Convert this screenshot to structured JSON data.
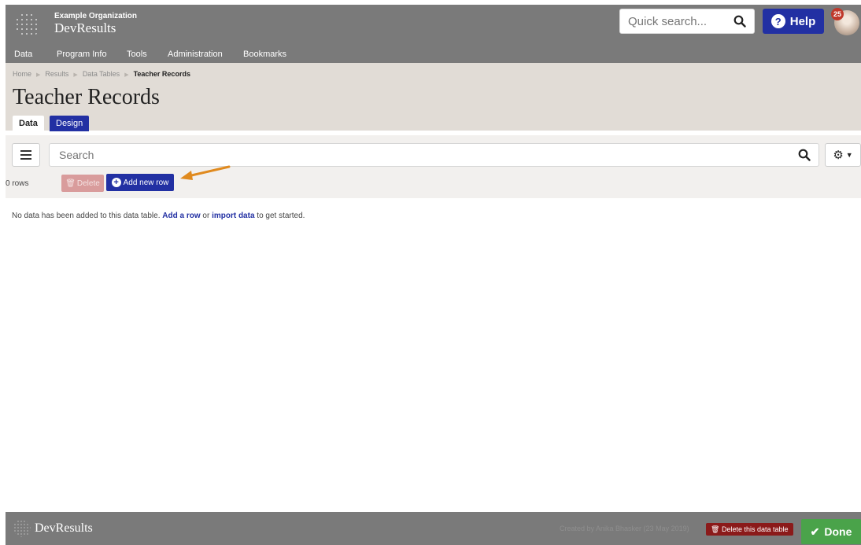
{
  "header": {
    "org_name": "Example Organization",
    "app_name": "DevResults",
    "quick_search_placeholder": "Quick search...",
    "help_label": "Help",
    "notification_count": "25"
  },
  "nav": {
    "items": [
      "Data",
      "Program Info",
      "Tools",
      "Administration",
      "Bookmarks"
    ]
  },
  "breadcrumb": {
    "items": [
      "Home",
      "Results",
      "Data Tables"
    ],
    "current": "Teacher Records"
  },
  "page": {
    "title": "Teacher Records",
    "tabs": [
      "Data",
      "Design"
    ]
  },
  "toolbar": {
    "search_placeholder": "Search",
    "rows_count": "0 rows",
    "delete_label": "Delete",
    "add_label": "Add new row"
  },
  "message": {
    "prefix": "No data has been added to this data table. ",
    "link1": "Add a row",
    "middle": " or ",
    "link2": "import data",
    "suffix": " to get started."
  },
  "footer": {
    "brand": "DevResults",
    "created_text": "Created by Anika Bhasker (23 May 2019)",
    "delete_table_label": "Delete this data table",
    "done_label": "Done"
  },
  "colors": {
    "header_bg": "#7a7a7a",
    "page_head_bg": "#e1dcd6",
    "accent_blue": "#2230a3",
    "done_green": "#4aa34a",
    "danger_red": "#8b1a1a",
    "arrow_orange": "#e08a1e"
  }
}
